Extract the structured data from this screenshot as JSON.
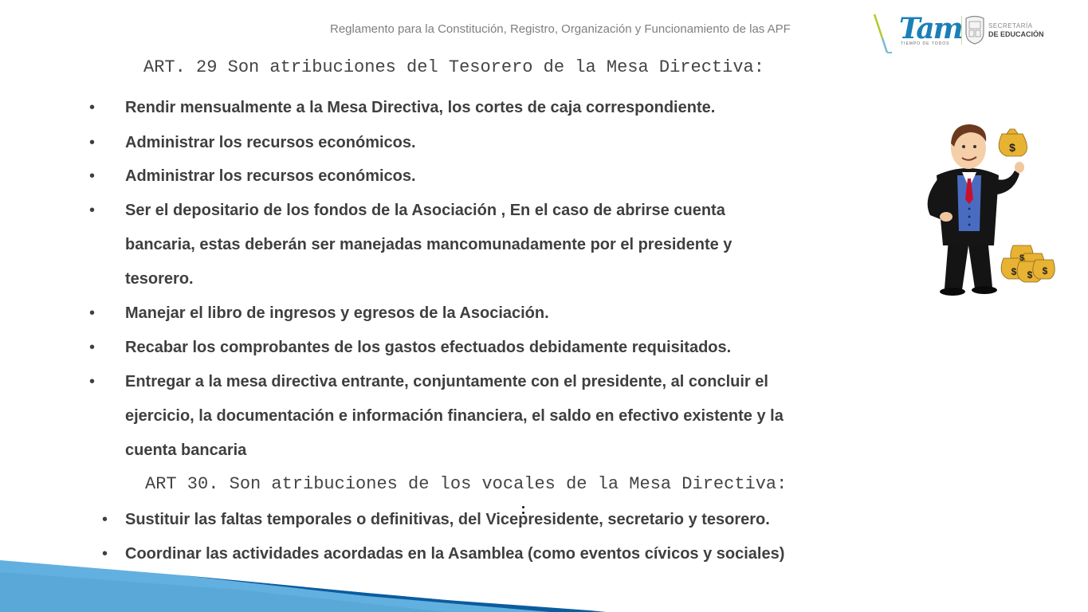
{
  "header": {
    "title": "Reglamento para la Constitución, Registro, Organización y Funcionamiento de las APF",
    "logos": {
      "tam_text": "Tam",
      "tam_tagline": "TIEMPO DE TODOS",
      "secretaria_line1": "SECRETARÍA",
      "secretaria_line2": "DE EDUCACIÓN"
    }
  },
  "art29": {
    "heading": "ART. 29 Son atribuciones del Tesorero de la Mesa Directiva:",
    "items": [
      {
        "lines": [
          "Rendir mensualmente a la Mesa Directiva, los cortes de  caja correspondiente."
        ]
      },
      {
        "lines": [
          "Administrar los recursos económicos."
        ]
      },
      {
        "lines": [
          "Administrar los recursos económicos."
        ]
      },
      {
        "lines": [
          "Ser el depositario de los fondos de la Asociación , En el caso de abrirse cuenta",
          "bancaria, estas deberán ser manejadas mancomunadamente por el presidente y",
          "tesorero."
        ]
      },
      {
        "lines": [
          "Manejar el libro de ingresos y egresos de la Asociación."
        ]
      },
      {
        "lines": [
          "Recabar los comprobantes de los gastos efectuados debidamente requisitados."
        ]
      },
      {
        "lines": [
          "Entregar a la mesa directiva entrante, conjuntamente con el presidente, al concluir el",
          "ejercicio, la documentación e información financiera,  el saldo en efectivo existente y la",
          "cuenta bancaria"
        ]
      }
    ]
  },
  "art30": {
    "heading": "ART 30. Son atribuciones de los vocales de la Mesa Directiva:",
    "items": [
      {
        "lines": [
          "Sustituir las faltas temporales o definitivas, del Vicepresidente, secretario y tesorero."
        ]
      },
      {
        "lines": [
          "Coordinar las actividades acordadas en la Asamblea (como eventos cívicos y sociales)"
        ]
      }
    ]
  },
  "bullet_glyph": "•",
  "illustration": {
    "icon": "treasurer-with-money-bags-illustration",
    "bag_symbol": "$"
  },
  "colors": {
    "body_text": "#3f3f3f",
    "header_text": "#7f7f7f",
    "wave_light": "#62b0e0",
    "wave_dark": "#0b5c9e",
    "tam_blue": "#1b7fb8",
    "slash_green": "#b5c92a"
  }
}
